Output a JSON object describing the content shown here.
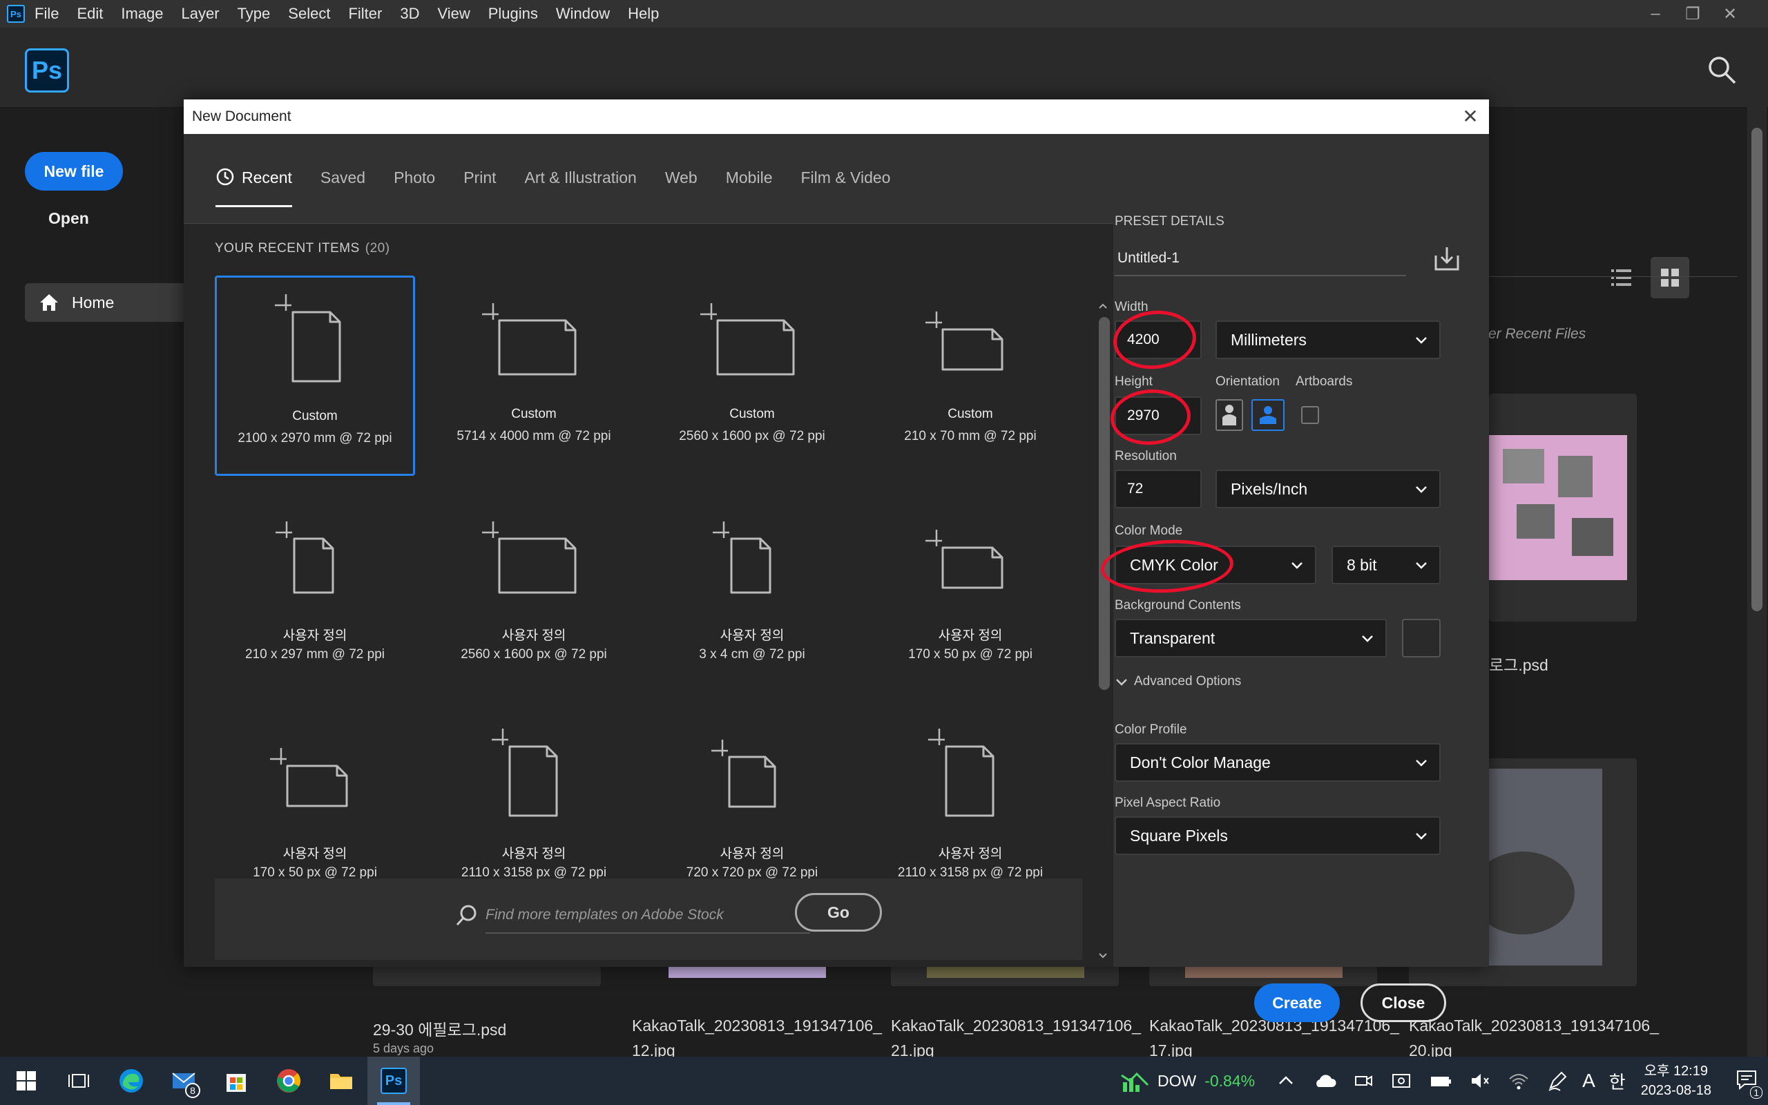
{
  "menubar": {
    "app_icon_label": "Ps",
    "items": [
      "File",
      "Edit",
      "Image",
      "Layer",
      "Type",
      "Select",
      "Filter",
      "3D",
      "View",
      "Plugins",
      "Window",
      "Help"
    ]
  },
  "home": {
    "logo": "Ps",
    "new_file": "New file",
    "open": "Open",
    "nav_home": "Home",
    "sort_label": "er Recent Files",
    "bg_partial_psd": "로그.psd",
    "files": [
      {
        "name": "29-30 에필로그.psd",
        "sub": "5 days ago"
      },
      {
        "name": "KakaoTalk_20230813_191347106_",
        "sub": "12.jpg"
      },
      {
        "name": "KakaoTalk_20230813_191347106_",
        "sub": "21.jpg"
      },
      {
        "name": "KakaoTalk_20230813_191347106_",
        "sub": "17.jpg"
      },
      {
        "name": "KakaoTalk_20230813_191347106_",
        "sub": "20.jpg"
      }
    ]
  },
  "dialog": {
    "title": "New Document",
    "tabs": [
      "Recent",
      "Saved",
      "Photo",
      "Print",
      "Art & Illustration",
      "Web",
      "Mobile",
      "Film & Video"
    ],
    "recent_title": "YOUR RECENT ITEMS",
    "recent_count": "(20)",
    "items": [
      {
        "name": "Custom",
        "dims": "2100 x 2970 mm @ 72 ppi",
        "shape": "portrait"
      },
      {
        "name": "Custom",
        "dims": "5714 x 4000 mm @ 72 ppi",
        "shape": "landscape"
      },
      {
        "name": "Custom",
        "dims": "2560 x 1600 px @ 72 ppi",
        "shape": "landscape"
      },
      {
        "name": "Custom",
        "dims": "210 x 70 mm @ 72 ppi",
        "shape": "wide"
      },
      {
        "name": "사용자 정의",
        "dims": "210 x 297 mm @ 72 ppi",
        "shape": "portrait-sm"
      },
      {
        "name": "사용자 정의",
        "dims": "2560 x 1600 px @ 72 ppi",
        "shape": "landscape"
      },
      {
        "name": "사용자 정의",
        "dims": "3 x 4 cm @ 72 ppi",
        "shape": "portrait-sm"
      },
      {
        "name": "사용자 정의",
        "dims": "170 x 50 px @ 72 ppi",
        "shape": "wide"
      },
      {
        "name": "사용자 정의",
        "dims": "170 x 50 px @ 72 ppi",
        "shape": "wide"
      },
      {
        "name": "사용자 정의",
        "dims": "2110 x 3158 px @ 72 ppi",
        "shape": "portrait"
      },
      {
        "name": "사용자 정의",
        "dims": "720 x 720 px @ 72 ppi",
        "shape": "square"
      },
      {
        "name": "사용자 정의",
        "dims": "2110 x 3158 px @ 72 ppi",
        "shape": "portrait"
      }
    ],
    "search_placeholder": "Find more templates on Adobe Stock",
    "go": "Go",
    "preset": {
      "header": "PRESET DETAILS",
      "doc_name": "Untitled-1",
      "width_label": "Width",
      "width_value": "4200",
      "width_unit": "Millimeters",
      "height_label": "Height",
      "height_value": "2970",
      "orientation_label": "Orientation",
      "artboards_label": "Artboards",
      "resolution_label": "Resolution",
      "resolution_value": "72",
      "resolution_unit": "Pixels/Inch",
      "color_mode_label": "Color Mode",
      "color_mode": "CMYK Color",
      "bit_depth": "8 bit",
      "bg_contents_label": "Background Contents",
      "bg_contents": "Transparent",
      "advanced": "Advanced Options",
      "color_profile_label": "Color Profile",
      "color_profile": "Don't Color Manage",
      "pixel_aspect_label": "Pixel Aspect Ratio",
      "pixel_aspect": "Square Pixels",
      "create": "Create",
      "close": "Close"
    }
  },
  "taskbar": {
    "mail_badge": "8",
    "stock_name": "DOW",
    "stock_change": "-0.84%",
    "ime_lang": "A",
    "ime_mode": "한",
    "time": "오후 12:19",
    "date": "2023-08-18",
    "notif_count": "1"
  },
  "colors": {
    "accent": "#1473e6",
    "selection": "#2680eb",
    "annotation": "#e8102a",
    "stock_negative": "#4cd964"
  }
}
